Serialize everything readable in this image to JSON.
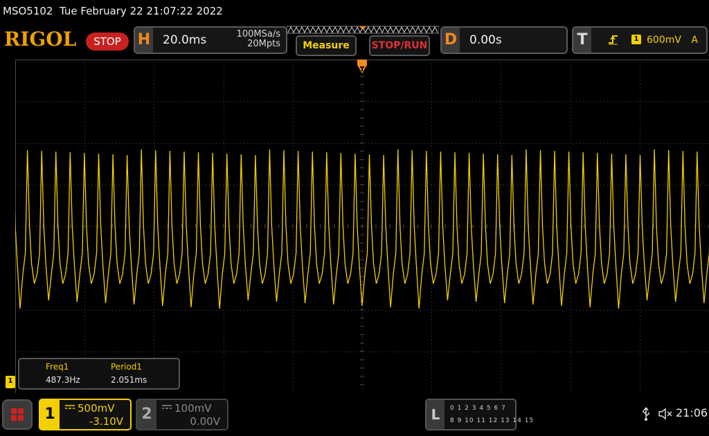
{
  "device": {
    "model": "MSO5102",
    "datetime": "Tue February 22 21:07:22 2022",
    "brand": "RIGOL",
    "run_state": "STOP"
  },
  "horizontal": {
    "key": "H",
    "timebase": "20.0ms",
    "sample_rate": "100MSa/s",
    "memory_depth": "20Mpts"
  },
  "buttons": {
    "measure": "Measure",
    "stop_run": "STOP/RUN"
  },
  "delay": {
    "key": "D",
    "value": "0.00s"
  },
  "trigger": {
    "key": "T",
    "edge_icon": "rising-edge-icon",
    "source": "1",
    "level": "600mV",
    "mode": "A"
  },
  "measurements": [
    {
      "label": "Freq1",
      "value": "487.3Hz"
    },
    {
      "label": "Period1",
      "value": "2.051ms"
    }
  ],
  "channels": [
    {
      "number": "1",
      "scale": "500mV",
      "offset": "-3.10V",
      "color": "#f5d000",
      "active": true
    },
    {
      "number": "2",
      "scale": "100mV",
      "offset": "0.00V",
      "color": "#8a8a8a",
      "active": false
    }
  ],
  "ch1_marker": "1",
  "logic_analyzer": {
    "key": "L",
    "row1": "0 1 2 3  4 5 6 7",
    "row2": "8 9 10 11 12 13 14 15"
  },
  "status": {
    "clock": "21:06"
  },
  "colors": {
    "trace": "#f5d000",
    "accent": "#f08a1c",
    "stop": "#c92121"
  }
}
